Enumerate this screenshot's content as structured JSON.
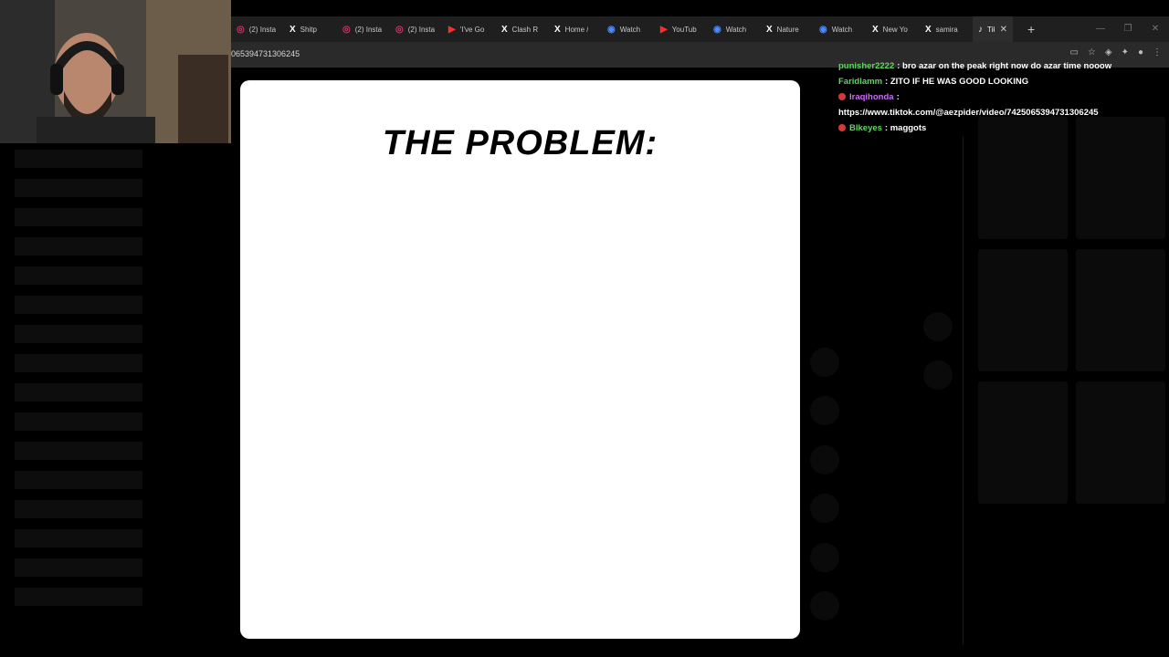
{
  "browser": {
    "tabs": [
      {
        "icon": "instagram-icon",
        "glyph": "◎",
        "color": "#e1306c",
        "label": "(2) Insta"
      },
      {
        "icon": "x-icon",
        "glyph": "X",
        "color": "#ffffff",
        "label": "Shitp"
      },
      {
        "icon": "instagram-icon",
        "glyph": "◎",
        "color": "#e1306c",
        "label": "(2) Insta"
      },
      {
        "icon": "instagram-icon",
        "glyph": "◎",
        "color": "#e1306c",
        "label": "(2) Insta"
      },
      {
        "icon": "youtube-icon",
        "glyph": "▶",
        "color": "#ff2d2d",
        "label": "'I've Go"
      },
      {
        "icon": "x-icon",
        "glyph": "X",
        "color": "#ffffff",
        "label": "Clash R"
      },
      {
        "icon": "x-icon",
        "glyph": "X",
        "color": "#ffffff",
        "label": "Home /"
      },
      {
        "icon": "watch-icon",
        "glyph": "◉",
        "color": "#4c8dff",
        "label": "Watch"
      },
      {
        "icon": "youtube-icon",
        "glyph": "▶",
        "color": "#ff2d2d",
        "label": "YouTub"
      },
      {
        "icon": "watch-icon",
        "glyph": "◉",
        "color": "#4c8dff",
        "label": "Watch"
      },
      {
        "icon": "x-icon",
        "glyph": "X",
        "color": "#ffffff",
        "label": "Nature"
      },
      {
        "icon": "watch-icon",
        "glyph": "◉",
        "color": "#4c8dff",
        "label": "Watch"
      },
      {
        "icon": "x-icon",
        "glyph": "X",
        "color": "#ffffff",
        "label": "New Yo"
      },
      {
        "icon": "x-icon",
        "glyph": "X",
        "color": "#ffffff",
        "label": "samira"
      }
    ],
    "active_tab": {
      "icon": "tiktok-icon",
      "glyph": "♪",
      "label": "Tik"
    },
    "close_glyph": "✕",
    "new_tab_glyph": "+",
    "url": "065394731306245",
    "window_controls": [
      "—",
      "❐",
      "✕"
    ],
    "toolbar_icons": [
      "cast-icon",
      "star-icon",
      "extension-icon",
      "puzzle-icon",
      "menu-icon"
    ]
  },
  "slide": {
    "title": "THE PROBLEM:"
  },
  "chat": {
    "messages": [
      {
        "user": "punisher2222",
        "color": "#63d463",
        "badge": false,
        "text": ": bro azar on the peak right now do azar time nooow"
      },
      {
        "user": "Faridlamm",
        "color": "#63d463",
        "badge": false,
        "text": ": ZITO IF HE WAS GOOD LOOKING"
      },
      {
        "user": "Iraqihonda",
        "color": "#c86cf0",
        "badge": true,
        "text": ":"
      },
      {
        "user": "",
        "color": "#ffffff",
        "badge": false,
        "text": "https://www.tiktok.com/@aezpider/video/7425065394731306245"
      },
      {
        "user": "Blkeyes",
        "color": "#63d463",
        "badge": true,
        "text": ": maggots"
      }
    ]
  }
}
